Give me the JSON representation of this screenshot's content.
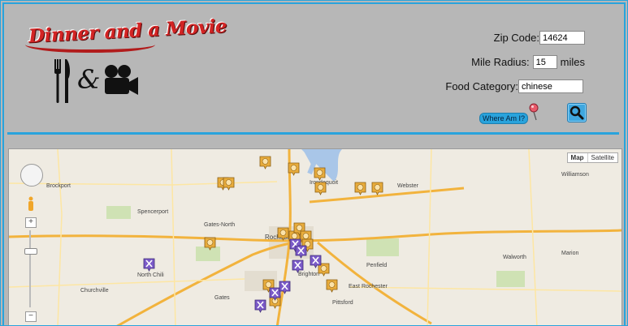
{
  "header": {
    "logo_text": "Dinner and a Movie",
    "logo_ampersand": "&"
  },
  "form": {
    "zip_label": "Zip Code:",
    "zip_value": "14624",
    "radius_label": "Mile Radius:",
    "radius_value": "15",
    "radius_unit": "miles",
    "food_label": "Food Category:",
    "food_value": "chinese",
    "where_button": "Where Am I?"
  },
  "map": {
    "type_map": "Map",
    "type_satellite": "Satellite",
    "zoom_in": "+",
    "zoom_out": "−",
    "places": [
      "Brockport",
      "Spencerport",
      "Gates-North",
      "Gates",
      "Rochester",
      "Irondequoit",
      "Webster",
      "Williamson",
      "North Chili",
      "Churchville",
      "Penfield",
      "Walworth",
      "Marion",
      "Brighton",
      "East Rochester",
      "Pittsford"
    ],
    "colors": {
      "food_marker": "#e8ac3c",
      "movie_marker": "#7b5ac8",
      "highway": "#f2b33d"
    }
  }
}
